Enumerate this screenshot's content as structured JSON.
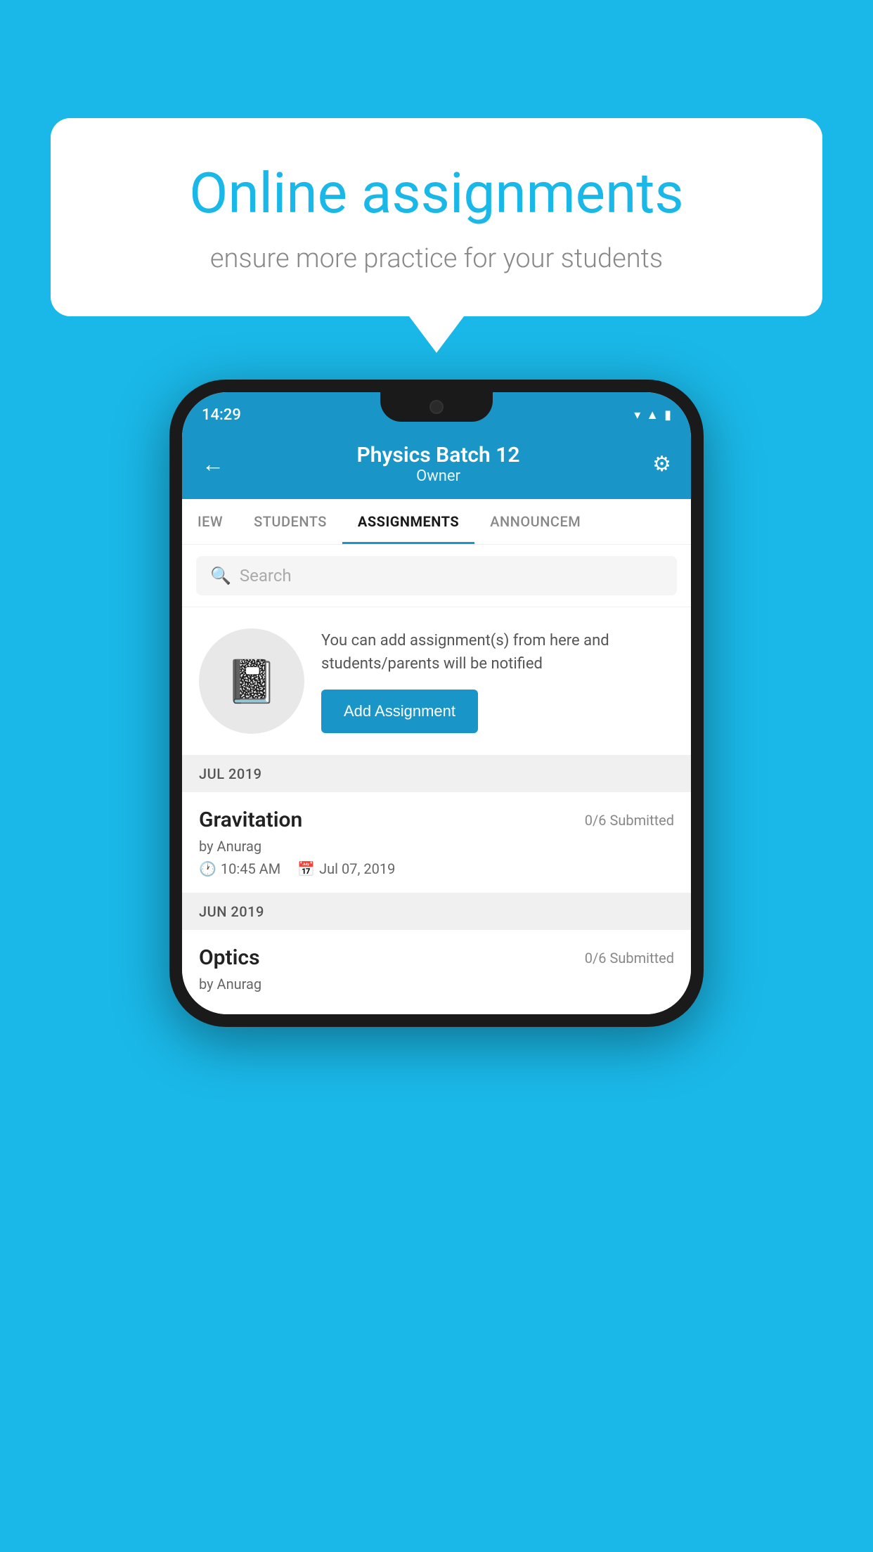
{
  "background_color": "#1ab8e8",
  "speech_bubble": {
    "title": "Online assignments",
    "subtitle": "ensure more practice for your students"
  },
  "status_bar": {
    "time": "14:29",
    "icons": [
      "wifi",
      "signal",
      "battery"
    ]
  },
  "header": {
    "title": "Physics Batch 12",
    "subtitle": "Owner",
    "back_label": "←",
    "gear_label": "⚙"
  },
  "tabs": [
    {
      "label": "IEW",
      "active": false
    },
    {
      "label": "STUDENTS",
      "active": false
    },
    {
      "label": "ASSIGNMENTS",
      "active": true
    },
    {
      "label": "ANNOUNCEM",
      "active": false
    }
  ],
  "search": {
    "placeholder": "Search"
  },
  "empty_state": {
    "description": "You can add assignment(s) from here and students/parents will be notified",
    "button_label": "Add Assignment"
  },
  "sections": [
    {
      "header": "JUL 2019",
      "assignments": [
        {
          "name": "Gravitation",
          "submitted": "0/6 Submitted",
          "by": "by Anurag",
          "time": "10:45 AM",
          "date": "Jul 07, 2019"
        }
      ]
    },
    {
      "header": "JUN 2019",
      "assignments": [
        {
          "name": "Optics",
          "submitted": "0/6 Submitted",
          "by": "by Anurag",
          "time": "",
          "date": ""
        }
      ]
    }
  ]
}
